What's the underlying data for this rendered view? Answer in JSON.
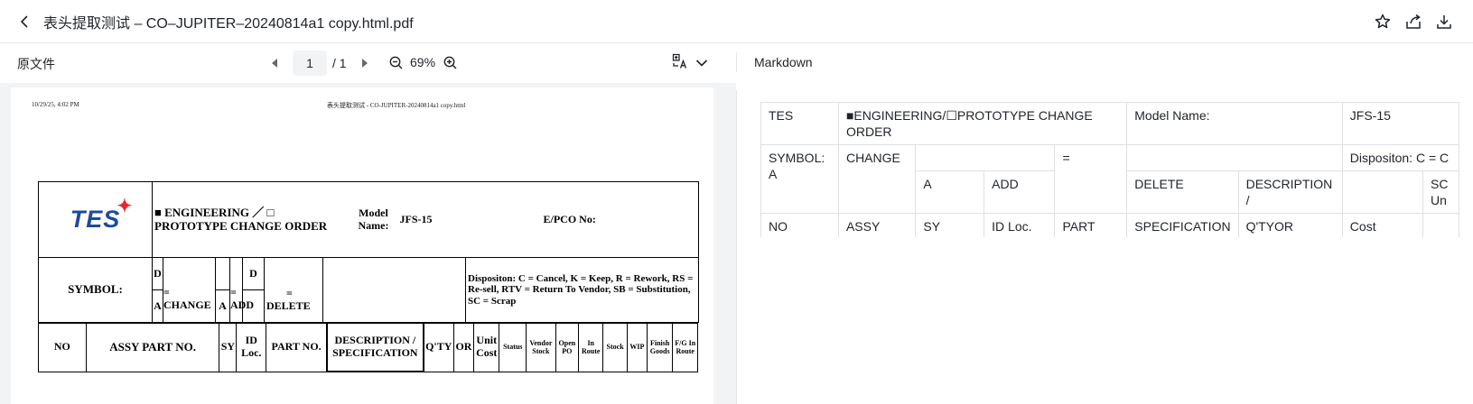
{
  "header": {
    "title": "表头提取测试 – CO–JUPITER–20240814a1 copy.html.pdf",
    "icons": [
      "back-icon",
      "star-icon",
      "share-icon",
      "download-icon"
    ]
  },
  "toolbar": {
    "left_label": "原文件",
    "page_current": "1",
    "page_total": "/ 1",
    "zoom": "69%",
    "right_label": "Markdown",
    "icons": [
      "prev-page-icon",
      "next-page-icon",
      "zoom-out-icon",
      "zoom-in-icon",
      "translate-icon",
      "chevron-down-icon"
    ]
  },
  "pdf": {
    "date": "10/29/25, 4:02 PM",
    "header": "表头提取测试 - CO-JUPITER-20240814a1 copy.html",
    "logo_text": "TES",
    "row1": {
      "order_type": "■ ENGINEERING ／ □ PROTOTYPE CHANGE ORDER",
      "model_label": "Model Name:",
      "model_value": "JFS-15",
      "epco_label": "E/PCO No:"
    },
    "row2": {
      "symbol": "SYMBOL:",
      "d1": "D",
      "a1": "A",
      "eq1": "=",
      "change": "CHANGE",
      "a2": "A",
      "eq2": "=",
      "add": "ADD",
      "d2": "D",
      "eq3": "=",
      "delete": "DELETE",
      "disposition": "Dispositon: C = Cancel, K = Keep, R = Rework, RS = Re-sell, RTV = Return To Vendor, SB = Substitution, SC = Scrap"
    },
    "columns": [
      "NO",
      "ASSY PART NO.",
      "SY",
      "ID Loc.",
      "PART NO.",
      "DESCRIPTION / SPECIFICATION",
      "Q'TY",
      "OR",
      "Unit Cost",
      "Status",
      "Vendor Stock",
      "Open PO",
      "In Route",
      "Stock",
      "WIP",
      "Finish Goods",
      "F/G In Route"
    ]
  },
  "markdown": {
    "r1": [
      "TES",
      "■ENGINEERING/☐PROTOTYPE CHANGE ORDER",
      "Model Name:",
      "JFS-15"
    ],
    "r2": [
      "SYMBOL: A",
      "CHANGE",
      "",
      "=",
      "",
      "Dispositon: C = C"
    ],
    "r3": [
      "A",
      "ADD",
      "DELETE",
      "DESCRIPTION /",
      "",
      "SC Un"
    ],
    "r4": [
      "NO",
      "ASSY PART NO.",
      "SY",
      "ID Loc.",
      "PART NO.",
      "SPECIFICATION",
      "Q'TYOR",
      "Cost",
      ""
    ]
  }
}
